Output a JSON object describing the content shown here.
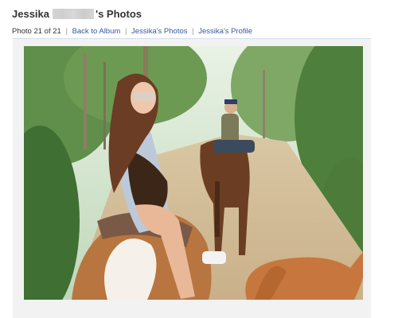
{
  "page": {
    "title_first": "Jessika",
    "title_suffix": "'s Photos",
    "photo_counter": "Photo 21 of 21",
    "links": {
      "back": "Back to Album",
      "user_photos": "Jessika's Photos",
      "profile": "Jessika's Profile"
    }
  },
  "colors": {
    "link": "#3b5998",
    "divider": "#d8dfea"
  },
  "photo": {
    "subject": "horse-riding-photo"
  }
}
